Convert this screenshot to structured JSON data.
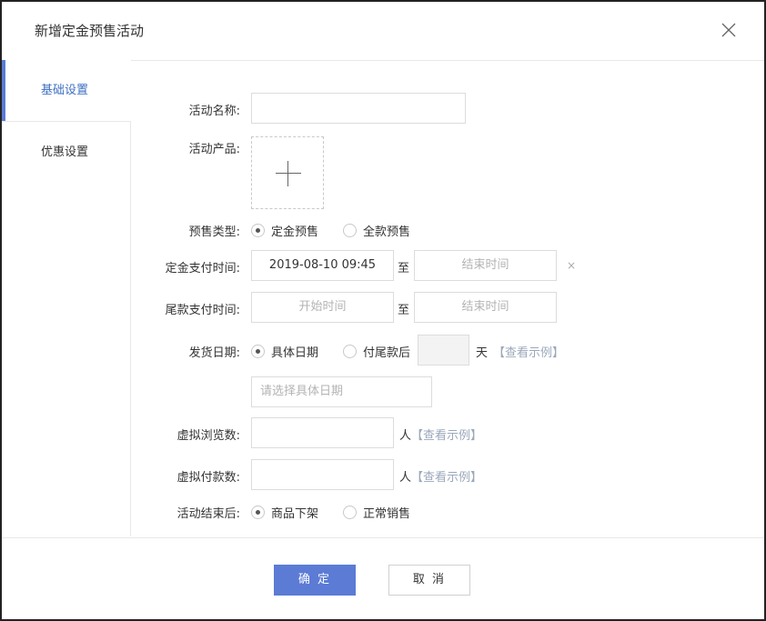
{
  "dialog": {
    "title": "新增定金预售活动",
    "close_icon": "close-icon"
  },
  "sidebar": {
    "tabs": [
      {
        "label": "基础设置",
        "active": true
      },
      {
        "label": "优惠设置",
        "active": false
      }
    ]
  },
  "form": {
    "activity_name": {
      "label": "活动名称:",
      "value": ""
    },
    "activity_product": {
      "label": "活动产品:",
      "icon": "plus-icon"
    },
    "presale_type": {
      "label": "预售类型:",
      "options": [
        {
          "label": "定金预售",
          "checked": true
        },
        {
          "label": "全款预售",
          "checked": false
        }
      ]
    },
    "deposit_time": {
      "label": "定金支付时间:",
      "start_value": "2019-08-10 09:45",
      "separator": "至",
      "end_placeholder": "结束时间",
      "clear_symbol": "×"
    },
    "balance_time": {
      "label": "尾款支付时间:",
      "start_placeholder": "开始时间",
      "separator": "至",
      "end_placeholder": "结束时间"
    },
    "ship_date": {
      "label": "发货日期:",
      "options": [
        {
          "label": "具体日期",
          "checked": true
        },
        {
          "label": "付尾款后",
          "checked": false
        }
      ],
      "days_value": "",
      "days_unit": "天",
      "example_link": "【查看示例】",
      "date_placeholder": "请选择具体日期"
    },
    "virtual_views": {
      "label": "虚拟浏览数:",
      "value": "",
      "unit": "人",
      "example_link": "【查看示例】"
    },
    "virtual_payments": {
      "label": "虚拟付款数:",
      "value": "",
      "unit": "人",
      "example_link": "【查看示例】"
    },
    "after_end": {
      "label": "活动结束后:",
      "options": [
        {
          "label": "商品下架",
          "checked": true
        },
        {
          "label": "正常销售",
          "checked": false
        }
      ]
    }
  },
  "footer": {
    "confirm_label": "确 定",
    "cancel_label": "取 消"
  },
  "colors": {
    "primary": "#5b7bd5",
    "active_tab_text": "#3e6fc2",
    "link": "#9ba8bb",
    "border": "#dcdcdc"
  }
}
